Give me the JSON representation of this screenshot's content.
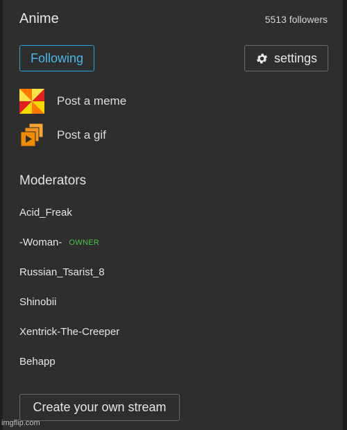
{
  "stream": {
    "title": "Anime",
    "followers": "5513 followers"
  },
  "actions": {
    "following_label": "Following",
    "settings_label": "settings",
    "settings_icon": "gear-icon"
  },
  "posts": [
    {
      "label": "Post a meme",
      "icon": "pinwheel-meme-icon"
    },
    {
      "label": "Post a gif",
      "icon": "gif-play-icon"
    }
  ],
  "moderators": {
    "heading": "Moderators",
    "list": [
      {
        "name": "Acid_Freak",
        "badge": ""
      },
      {
        "name": "-Woman-",
        "badge": "OWNER"
      },
      {
        "name": "Russian_Tsarist_8",
        "badge": ""
      },
      {
        "name": "Shinobii",
        "badge": ""
      },
      {
        "name": "Xentrick-The-Creeper",
        "badge": ""
      },
      {
        "name": "Behapp",
        "badge": ""
      }
    ]
  },
  "create_label": "Create your own stream",
  "watermark": "imgflip.com",
  "colors": {
    "panel": "#2e2e2e",
    "accent_blue": "#2aa3d8",
    "owner_green": "#4cc24c",
    "gif_orange": "#f08a00"
  }
}
